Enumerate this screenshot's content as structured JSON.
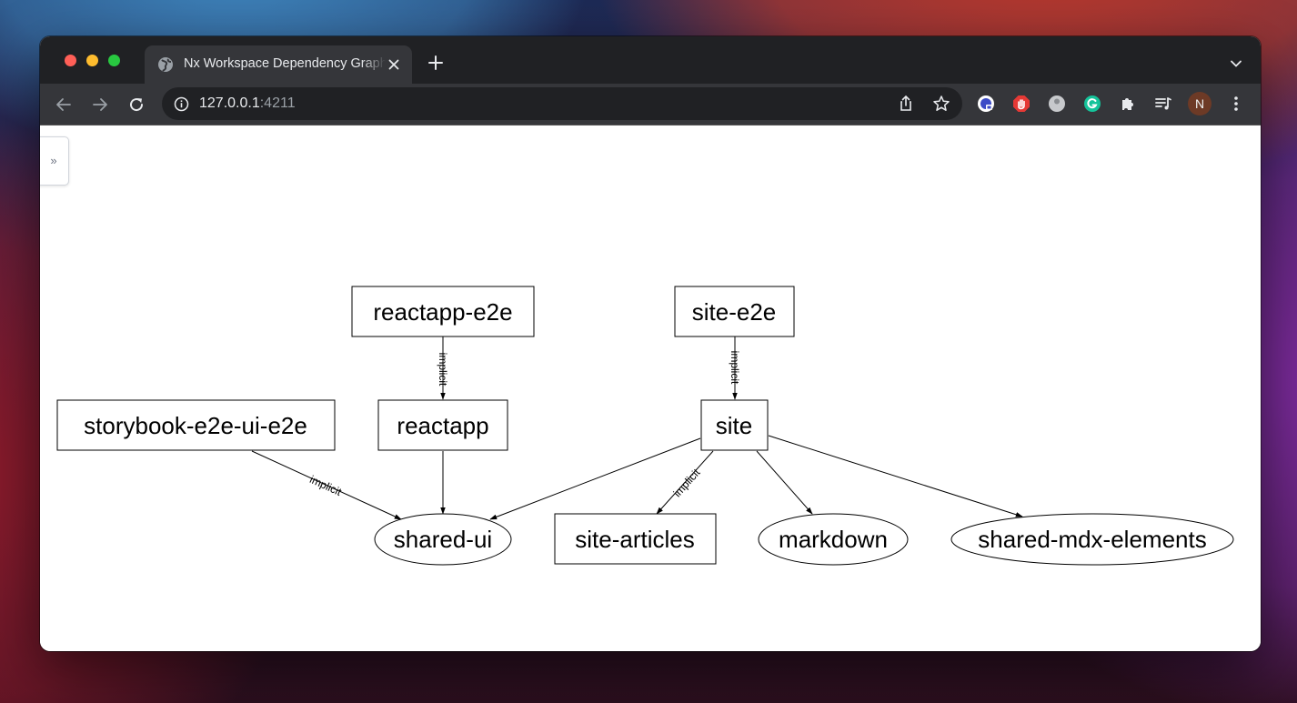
{
  "browser": {
    "tab_title": "Nx Workspace Dependency Graph",
    "url_host": "127.0.0.1",
    "url_port": ":4211",
    "profile_initial": "N",
    "tab_icon": "globe-icon"
  },
  "sidebar": {
    "toggle_label": "»"
  },
  "graph": {
    "nodes": {
      "reactapp_e2e": "reactapp-e2e",
      "site_e2e": "site-e2e",
      "storybook_e2e_ui_e2e": "storybook-e2e-ui-e2e",
      "reactapp": "reactapp",
      "site": "site",
      "shared_ui": "shared-ui",
      "site_articles": "site-articles",
      "markdown": "markdown",
      "shared_mdx_elements": "shared-mdx-elements"
    },
    "edges": [
      {
        "from": "reactapp-e2e",
        "to": "reactapp",
        "label": "implicit"
      },
      {
        "from": "site-e2e",
        "to": "site",
        "label": "implicit"
      },
      {
        "from": "storybook-e2e-ui-e2e",
        "to": "shared-ui",
        "label": "implicit"
      },
      {
        "from": "reactapp",
        "to": "shared-ui",
        "label": ""
      },
      {
        "from": "site",
        "to": "shared-ui",
        "label": ""
      },
      {
        "from": "site",
        "to": "site-articles",
        "label": "implicit"
      },
      {
        "from": "site",
        "to": "markdown",
        "label": ""
      },
      {
        "from": "site",
        "to": "shared-mdx-elements",
        "label": ""
      }
    ]
  },
  "colors": {
    "titlebar": "#202124",
    "toolbar": "#35363a",
    "close_light": "#ff5f57",
    "minimize_light": "#febc2e",
    "zoom_light": "#28c840",
    "profile_avatar": "#6d3a26"
  }
}
